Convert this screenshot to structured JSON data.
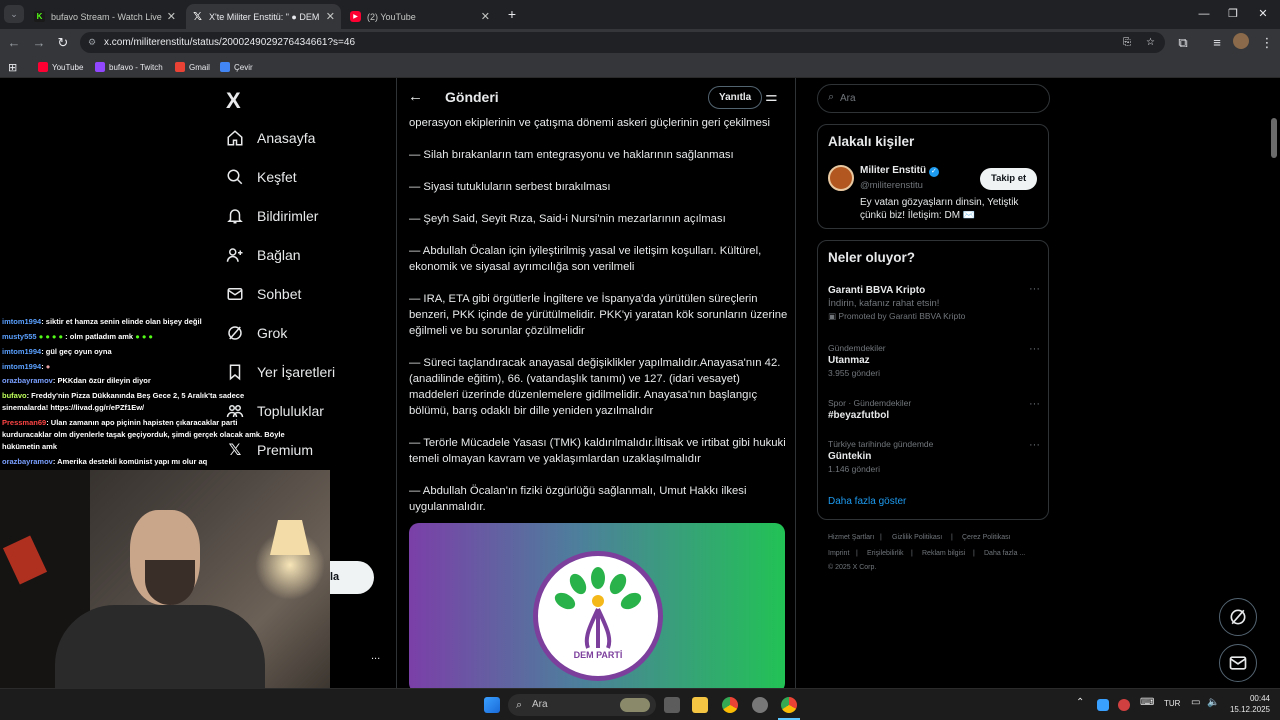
{
  "browser": {
    "tabs": [
      {
        "label": "bufavo Stream - Watch Live on",
        "favicon": "kick-icon",
        "color": "#53fc18",
        "active": false
      },
      {
        "label": "X'te Militer Enstitü: \" ● DEM P",
        "favicon": "x-icon",
        "color": "#ffffff",
        "active": true
      },
      {
        "label": "(2) YouTube",
        "favicon": "youtube-icon",
        "color": "#ff0033",
        "active": false
      }
    ],
    "url": "x.com/militerenstitu/status/2000249029276434661?s=46",
    "bookmarks": [
      {
        "label": "YouTube",
        "color": "#ff0033"
      },
      {
        "label": "bufavo - Twitch",
        "color": "#9146ff"
      },
      {
        "label": "Gmail",
        "color": "#ea4335"
      },
      {
        "label": "Çevir",
        "color": "#4285f4"
      }
    ]
  },
  "x_logo": "X",
  "nav": [
    {
      "label": "Anasayfa",
      "icon": "home-icon"
    },
    {
      "label": "Keşfet",
      "icon": "search-icon"
    },
    {
      "label": "Bildirimler",
      "icon": "bell-icon"
    },
    {
      "label": "Bağlan",
      "icon": "add-user-icon"
    },
    {
      "label": "Sohbet",
      "icon": "mail-icon"
    },
    {
      "label": "Grok",
      "icon": "grok-icon"
    },
    {
      "label": "Yer İşaretleri",
      "icon": "bookmark-icon"
    },
    {
      "label": "Topluluklar",
      "icon": "people-icon"
    },
    {
      "label": "Premium",
      "icon": "x-icon"
    }
  ],
  "post_button_partial": "la",
  "more_dots": "...",
  "post": {
    "header_title": "Gönderi",
    "reply_button": "Yanıtla",
    "paragraphs": [
      "operasyon ekiplerinin ve çatışma dönemi askeri güçlerinin geri çekilmesi",
      "— Silah bırakanların tam entegrasyonu ve haklarının sağlanması",
      "— Siyasi tutukluların serbest bırakılması",
      "— Şeyh Said, Seyit Rıza, Said-i Nursi'nin mezarlarının açılması",
      "— Abdullah Öcalan için iyileştirilmiş yasal ve iletişim koşulları. Kültürel, ekonomik ve siyasal ayrımcılığa son verilmeli",
      "— IRA, ETA gibi örgütlerle İngiltere ve İspanya'da yürütülen süreçlerin benzeri, PKK içinde de yürütülmelidir. PKK'yi yaratan kök sorunların üzerine eğilmeli ve bu sorunlar çözülmelidir",
      "— Süreci taçlandıracak anayasal değişiklikler yapılmalıdır.Anayasa'nın 42. (anadilinde eğitim), 66. (vatandaşlık tanımı) ve 127. (idari vesayet) maddeleri üzerinde düzenlemelere gidilmelidir. Anayasa'nın başlangıç bölümü, barış odaklı bir dille yeniden yazılmalıdır",
      "— Terörle Mücadele Yasası (TMK) kaldırılmalıdır.İltisak ve irtibat gibi hukuki temeli olmayan kavram ve yaklaşımlardan uzaklaşılmalıdır",
      "— Abdullah Öcalan'ın fiziki özgürlüğü sağlanmalı, Umut Hakkı ilkesi uygulanmalıdır."
    ],
    "image_logo_text": "DEM PARTİ"
  },
  "search": {
    "placeholder": "Ara"
  },
  "people": {
    "title": "Alakalı kişiler",
    "name": "Militer Enstitü",
    "handle": "@militerenstitu",
    "follow": "Takip et",
    "bio": "Ey vatan gözyaşların dinsin, Yetiştik çünkü biz! İletişim: DM ✉️"
  },
  "trends": {
    "title": "Neler oluyor?",
    "items": [
      {
        "meta": "",
        "name": "Garanti BBVA Kripto",
        "sub": "İndirin, kafanız rahat etsin!",
        "promo": "Promoted by Garanti BBVA Kripto"
      },
      {
        "meta": "Gündemdekiler",
        "name": "Utanmaz",
        "sub": "3.955 gönderi",
        "promo": ""
      },
      {
        "meta": "Spor · Gündemdekiler",
        "name": "#beyazfutbol",
        "sub": "",
        "promo": ""
      },
      {
        "meta": "Türkiye tarihinde gündemde",
        "name": "Güntekin",
        "sub": "1.146 gönderi",
        "promo": ""
      }
    ],
    "show_more": "Daha fazla göster",
    "dots": "···"
  },
  "footer": {
    "links": [
      "Hizmet Şartları",
      "Gizlilik Politikası",
      "Çerez Politikası",
      "Imprint",
      "Erişilebilirlik",
      "Reklam bilgisi",
      "Daha fazla ..."
    ],
    "copyright": "© 2025 X Corp."
  },
  "chat": [
    {
      "user": "imtom1994",
      "msg": ": siktir et hamza senin elinde olan bişey değil",
      "color": "#5aa0ff"
    },
    {
      "user": "musty555",
      "msg": ": olm patladım amk",
      "color": "#5aa0ff"
    },
    {
      "user": "imtom1994",
      "msg": ": gül geç oyun oyna",
      "color": "#5aa0ff"
    },
    {
      "user": "imtom1994",
      "msg": ":",
      "color": "#5aa0ff"
    },
    {
      "user": "orazbayramov",
      "msg": ": PKKdan özür dileyin diyor",
      "color": "#7aa0ff"
    },
    {
      "user": "bufavo",
      "msg": ": Freddy'nin Pizza Dükkanında Beş Gece 2, 5 Aralık'ta sadece",
      "color": "#bfff5a"
    },
    {
      "user": "",
      "msg": "sinemalarda! https://livad.gg/r/ePZf1Ew/",
      "color": "#ffffff"
    },
    {
      "user": "Pressman69",
      "msg": ": Ulan zamanın apo piçinin hapisten çıkaracaklar parti",
      "color": "#ff4444"
    },
    {
      "user": "",
      "msg": "kurduracaklar olm diyenlerle taşak geçiyorduk, şimdi gerçek olacak amk. Böyle",
      "color": "#ffffff"
    },
    {
      "user": "",
      "msg": "hükümetin amk",
      "color": "#ffffff"
    },
    {
      "user": "orazbayramov",
      "msg": ": Amerika destekli komünist yapı mı olur aq",
      "color": "#7aa0ff"
    }
  ],
  "taskbar": {
    "search_placeholder": "Ara",
    "lang": "TUR",
    "time": "00:44",
    "date": "15.12.2025"
  }
}
